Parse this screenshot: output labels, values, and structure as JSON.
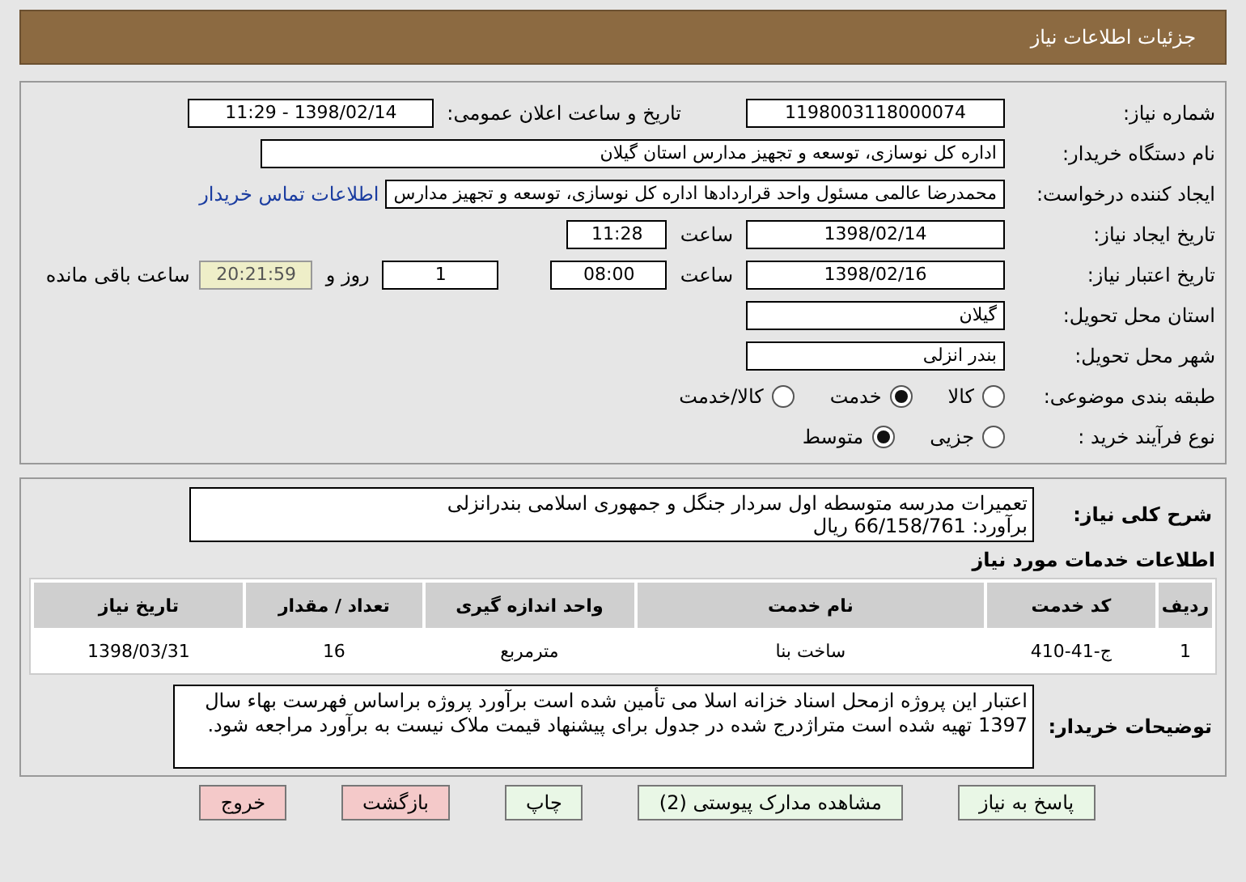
{
  "header": {
    "title": "جزئیات اطلاعات نیاز"
  },
  "need_number": {
    "label": "شماره نیاز:",
    "value": "1198003118000074"
  },
  "announce": {
    "label": "تاریخ و ساعت اعلان عمومی:",
    "value": "1398/02/14 - 11:29"
  },
  "buyer": {
    "label": "نام دستگاه خریدار:",
    "value": "اداره کل نوسازی، توسعه و تجهیز مدارس استان گیلان"
  },
  "requester": {
    "label": "ایجاد کننده درخواست:",
    "value": "محمدرضا عالمی مسئول واحد قراردادها اداره کل نوسازی، توسعه و تجهیز مدارس",
    "link": "اطلاعات تماس خریدار"
  },
  "created": {
    "label": "تاریخ ایجاد نیاز:",
    "date": "1398/02/14",
    "time_label": "ساعت",
    "time": "11:28"
  },
  "validity": {
    "label": "تاریخ اعتبار نیاز:",
    "date": "1398/02/16",
    "time_label": "ساعت",
    "time": "08:00",
    "days": "1",
    "days_label": "روز و",
    "remaining": "20:21:59",
    "remaining_label": "ساعت باقی مانده"
  },
  "province": {
    "label": "استان محل تحویل:",
    "value": "گیلان"
  },
  "city": {
    "label": "شهر محل تحویل:",
    "value": "بندر انزلی"
  },
  "category": {
    "label": "طبقه بندی موضوعی:",
    "options": [
      {
        "label": "کالا",
        "selected": false
      },
      {
        "label": "خدمت",
        "selected": true
      },
      {
        "label": "کالا/خدمت",
        "selected": false
      }
    ]
  },
  "process": {
    "label": "نوع فرآیند خرید :",
    "options": [
      {
        "label": "جزیی",
        "selected": false
      },
      {
        "label": "متوسط",
        "selected": true
      }
    ]
  },
  "summary": {
    "label": "شرح کلی نیاز:",
    "line": "تعمیرات مدرسه متوسطه اول سردار جنگل و جمهوری اسلامی بندرانزلی",
    "estimate": "برآورد: 66/158/761 ریال"
  },
  "services": {
    "title": "اطلاعات خدمات مورد نیاز",
    "columns": [
      "ردیف",
      "کد خدمت",
      "نام خدمت",
      "واحد اندازه گیری",
      "تعداد / مقدار",
      "تاریخ نیاز"
    ],
    "rows": [
      [
        "1",
        "ج-41-410",
        "ساخت بنا",
        "مترمربع",
        "16",
        "1398/03/31"
      ]
    ]
  },
  "notes": {
    "label": "توضیحات خریدار:",
    "value": "اعتبار این پروژه ازمحل اسناد خزانه اسلا می تأمین شده است برآورد پروژه براساس فهرست بهاء سال 1397 تهیه شده است متراژدرج شده در جدول برای پیشنهاد قیمت ملاک نیست به برآورد مراجعه شود."
  },
  "buttons": [
    {
      "label": "پاسخ به نیاز",
      "kind": "action"
    },
    {
      "label": "مشاهده مدارک پیوستی (2)",
      "kind": "action"
    },
    {
      "label": "چاپ",
      "kind": "action"
    },
    {
      "label": "بازگشت",
      "kind": "exit"
    },
    {
      "label": "خروج",
      "kind": "exit"
    }
  ]
}
